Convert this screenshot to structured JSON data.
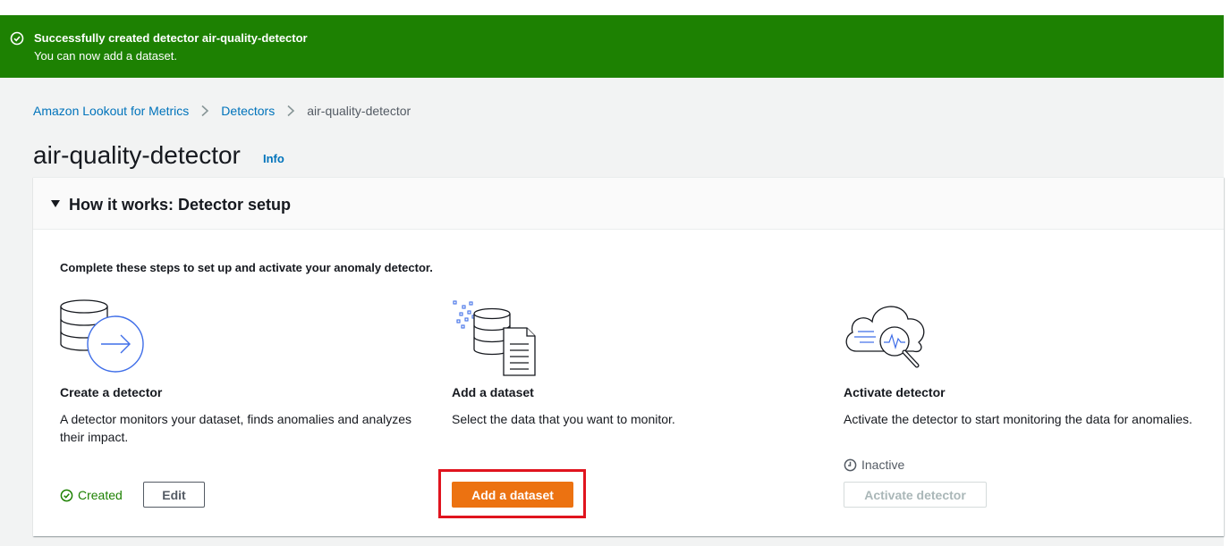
{
  "flash": {
    "icon": "check-circle-icon",
    "title": "Successfully created detector air-quality-detector",
    "message": "You can now add a dataset."
  },
  "breadcrumb": {
    "items": [
      "Amazon Lookout for Metrics",
      "Detectors"
    ],
    "current": "air-quality-detector"
  },
  "page": {
    "title": "air-quality-detector",
    "info_label": "Info"
  },
  "panel": {
    "title": "How it works: Detector setup",
    "intro": "Complete these steps to set up and activate your anomaly detector.",
    "steps": [
      {
        "icon": "database-arrow-icon",
        "title": "Create a detector",
        "description": "A detector monitors your dataset, finds anomalies and analyzes their impact.",
        "status": "Created",
        "button": "Edit"
      },
      {
        "icon": "database-document-icon",
        "title": "Add a dataset",
        "description": "Select the data that you want to monitor.",
        "button": "Add a dataset"
      },
      {
        "icon": "cloud-magnifier-icon",
        "title": "Activate detector",
        "description": "Activate the detector to start monitoring the data for anomalies.",
        "status": "Inactive",
        "button": "Activate detector"
      }
    ]
  },
  "colors": {
    "success": "#1d8102",
    "link": "#0073bb",
    "primary_button": "#ec7211",
    "highlight": "#e0141e"
  }
}
